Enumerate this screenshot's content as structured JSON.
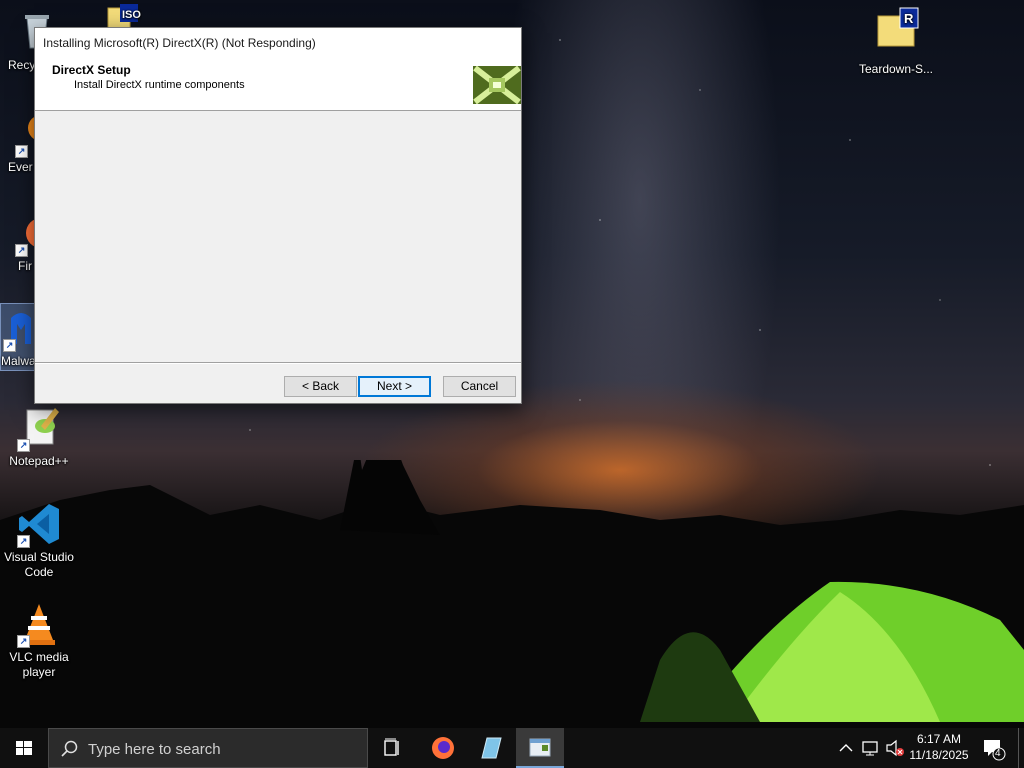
{
  "dialog": {
    "title": "Installing Microsoft(R) DirectX(R) (Not Responding)",
    "header_title": "DirectX Setup",
    "header_subtitle": "Install DirectX runtime components",
    "buttons": {
      "back": "< Back",
      "next": "Next >",
      "cancel": "Cancel"
    }
  },
  "desktop": {
    "icons": [
      {
        "label": "Recy",
        "icon": "recycle-bin-icon"
      },
      {
        "label": "",
        "icon": "iso-file-icon"
      },
      {
        "label": "Ever",
        "icon": "everything-search-icon"
      },
      {
        "label": "Fir",
        "icon": "firefox-icon"
      },
      {
        "label": "Malwa",
        "icon": "malwarebytes-icon"
      },
      {
        "label": "Notepad++",
        "icon": "notepad-plus-plus-icon"
      },
      {
        "label": "Visual Studio Code",
        "icon": "vscode-icon"
      },
      {
        "label": "VLC media player",
        "icon": "vlc-icon"
      },
      {
        "label": "Teardown-S...",
        "icon": "folder-r-icon"
      }
    ]
  },
  "taskbar": {
    "search_placeholder": "Type here to search",
    "time": "6:17 AM",
    "date": "11/18/2025",
    "notification_count": "4"
  },
  "colors": {
    "taskbar_bg": "#101010",
    "dialog_bg": "#f0f0f0",
    "accent": "#0078d7"
  }
}
